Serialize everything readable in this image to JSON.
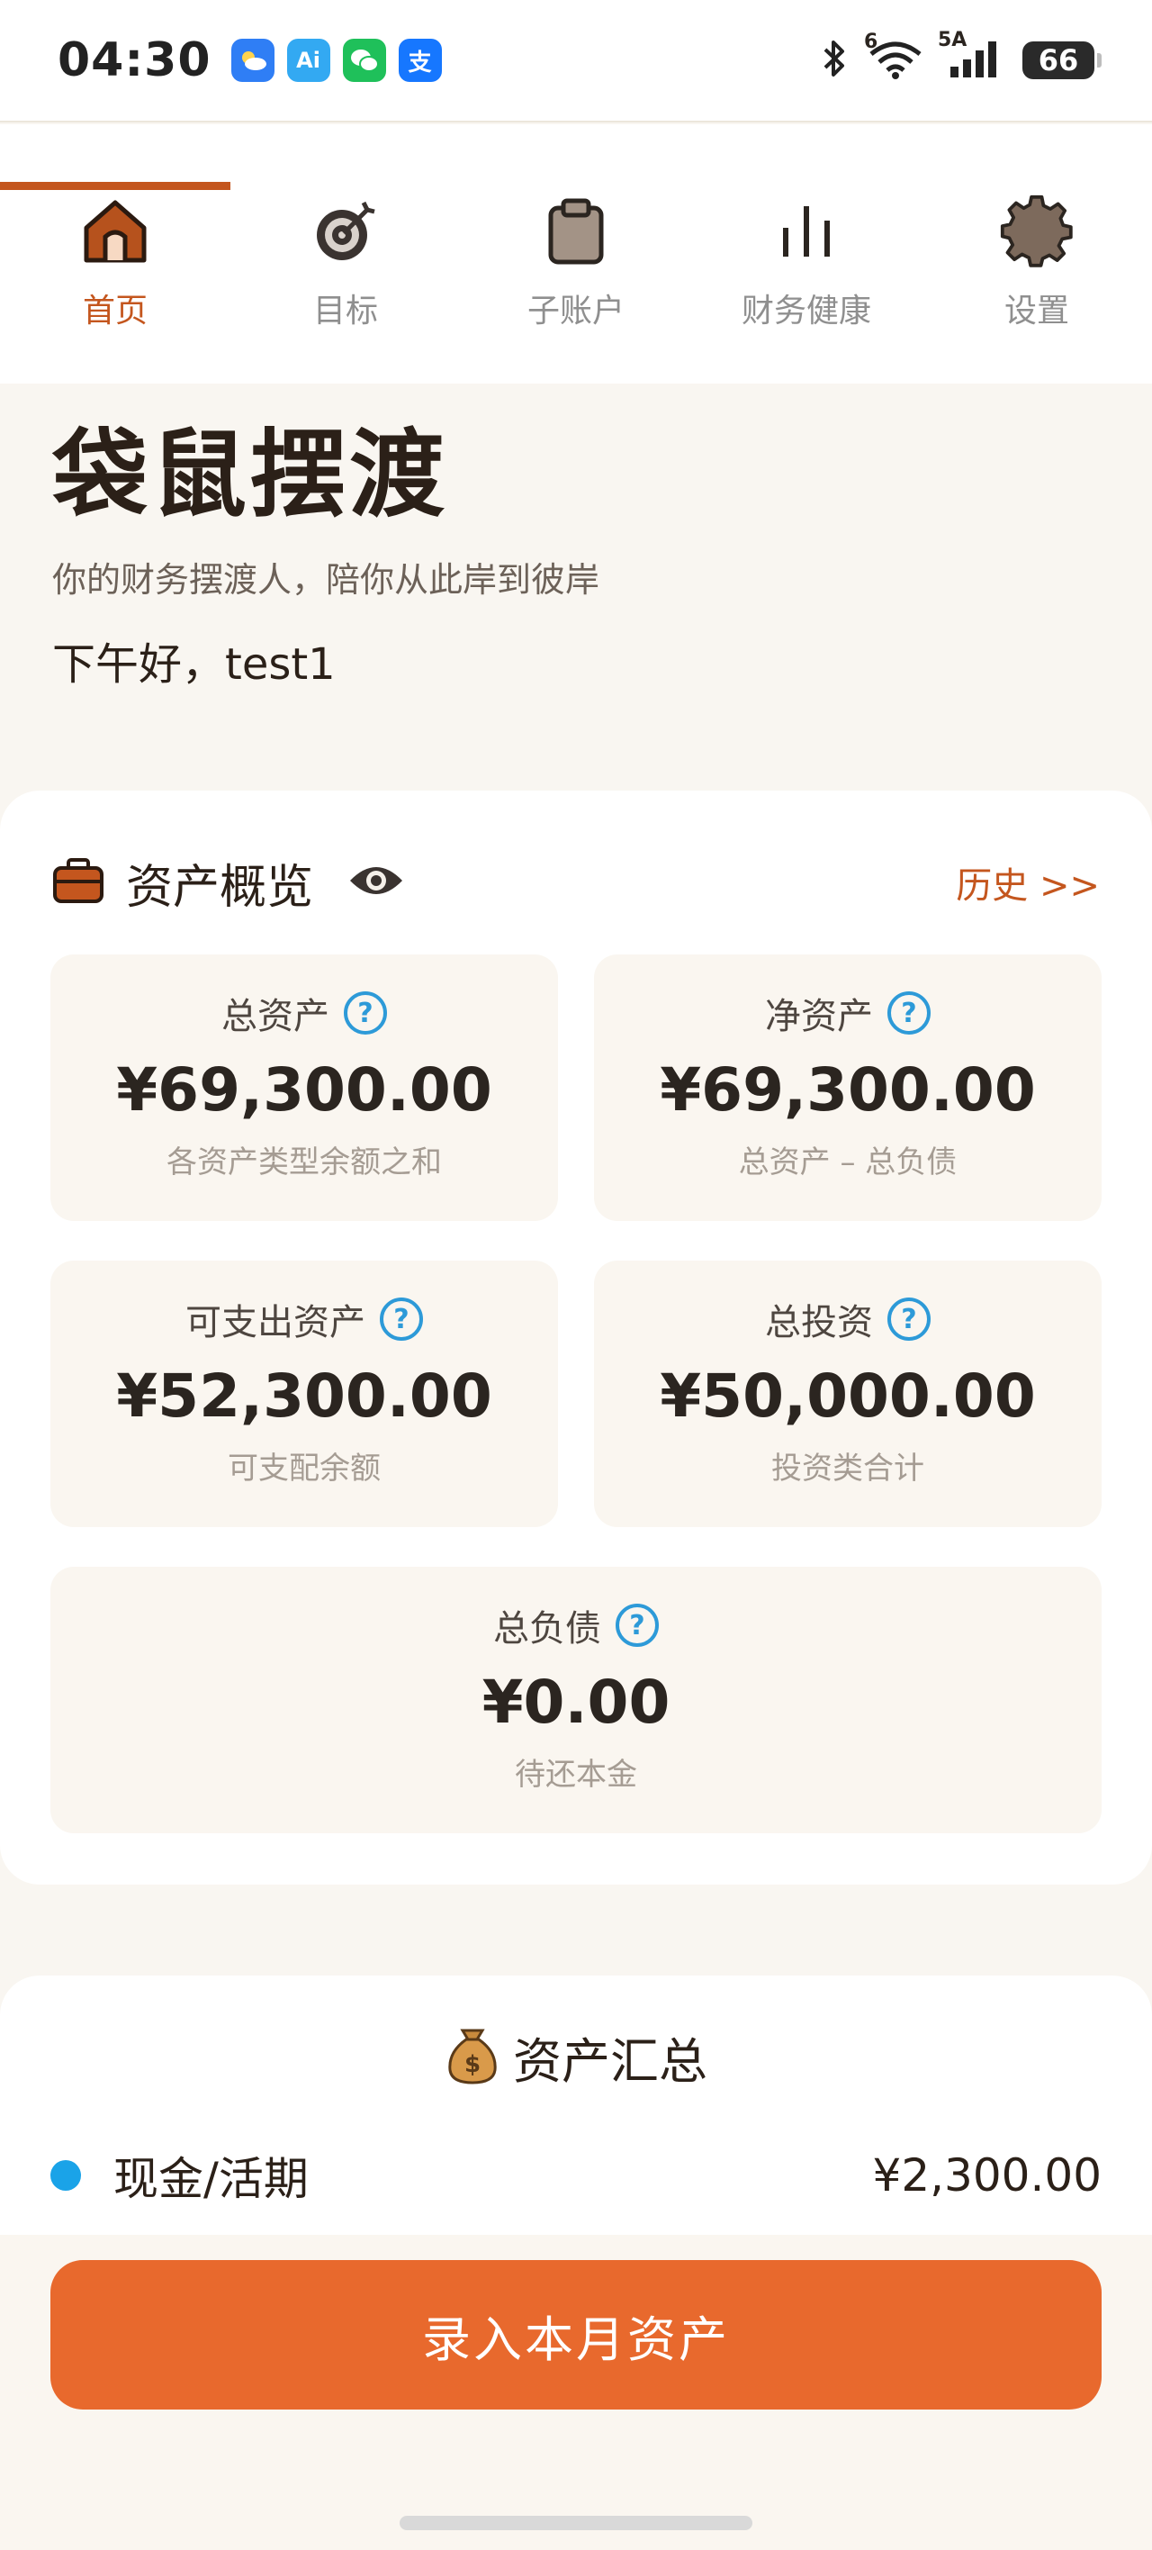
{
  "status_bar": {
    "time": "04:30",
    "app_icons": [
      "weather-icon",
      "ai-icon",
      "wechat-icon",
      "alipay-icon"
    ],
    "ai_label": "Ai",
    "alipay_label": "支",
    "network_label": "5A",
    "wifi_label": "6",
    "battery": "66"
  },
  "nav": {
    "items": [
      {
        "label": "首页",
        "icon": "home-icon",
        "active": true
      },
      {
        "label": "目标",
        "icon": "target-icon",
        "active": false
      },
      {
        "label": "子账户",
        "icon": "clipboard-icon",
        "active": false
      },
      {
        "label": "财务健康",
        "icon": "bar-chart-icon",
        "active": false
      },
      {
        "label": "设置",
        "icon": "gear-icon",
        "active": false
      }
    ]
  },
  "hero": {
    "title": "袋鼠摆渡",
    "subtitle": "你的财务摆渡人，陪你从此岸到彼岸",
    "greeting": "下午好，test1"
  },
  "overview": {
    "title": "资产概览",
    "history_link": "历史 >>",
    "help_glyph": "?",
    "metrics": [
      {
        "label": "总资产",
        "value": "¥69,300.00",
        "desc": "各资产类型余额之和"
      },
      {
        "label": "净资产",
        "value": "¥69,300.00",
        "desc": "总资产 – 总负债"
      },
      {
        "label": "可支出资产",
        "value": "¥52,300.00",
        "desc": "可支配余额"
      },
      {
        "label": "总投资",
        "value": "¥50,000.00",
        "desc": "投资类合计"
      },
      {
        "label": "总负债",
        "value": "¥0.00",
        "desc": "待还本金"
      }
    ]
  },
  "summary": {
    "title": "资产汇总",
    "icon": "money-bag-icon",
    "rows": [
      {
        "label": "现金/活期",
        "value": "¥2,300.00",
        "color": "#1aa3e8"
      }
    ]
  },
  "action": {
    "button_label": "录入本月资产"
  },
  "colors": {
    "accent": "#c4561e",
    "button": "#e8692d",
    "help": "#2d9ad8",
    "background": "#f9f6f1"
  }
}
